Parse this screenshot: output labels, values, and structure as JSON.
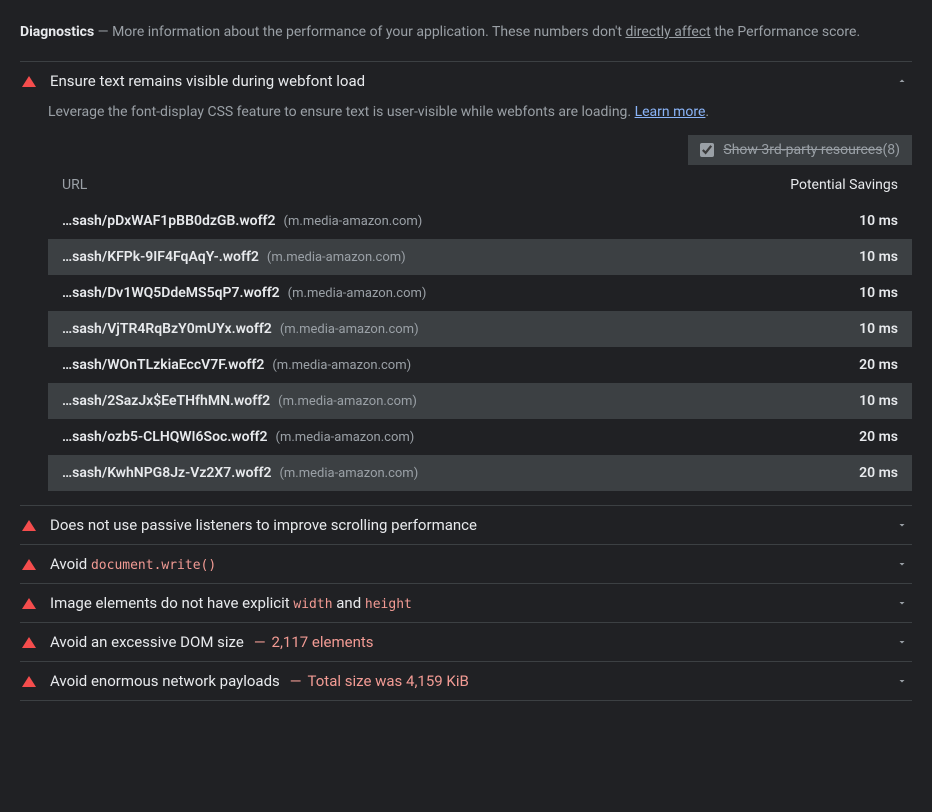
{
  "header": {
    "title": "Diagnostics",
    "dash": " — ",
    "intro1": "More information about the performance of your application. These numbers don't ",
    "link": "directly affect",
    "intro2": " the Performance score."
  },
  "audit0": {
    "title": "Ensure text remains visible during webfont load",
    "desc1": "Leverage the font-display CSS feature to ensure text is user-visible while webfonts are loading. ",
    "learn": "Learn more",
    "desc2": ".",
    "thirdPartyLabel": "Show 3rd-party resources",
    "thirdPartyCount": " (8)",
    "colUrl": "URL",
    "colSavings": "Potential Savings",
    "rows": [
      {
        "url": "…sash/pDxWAF1pBB0dzGB.woff2",
        "host": "(m.media-amazon.com)",
        "savings": "10 ms"
      },
      {
        "url": "…sash/KFPk-9IF4FqAqY-.woff2",
        "host": "(m.media-amazon.com)",
        "savings": "10 ms"
      },
      {
        "url": "…sash/Dv1WQ5DdeMS5qP7.woff2",
        "host": "(m.media-amazon.com)",
        "savings": "10 ms"
      },
      {
        "url": "…sash/VjTR4RqBzY0mUYx.woff2",
        "host": "(m.media-amazon.com)",
        "savings": "10 ms"
      },
      {
        "url": "…sash/WOnTLzkiaEccV7F.woff2",
        "host": "(m.media-amazon.com)",
        "savings": "20 ms"
      },
      {
        "url": "…sash/2SazJx$EeTHfhMN.woff2",
        "host": "(m.media-amazon.com)",
        "savings": "10 ms"
      },
      {
        "url": "…sash/ozb5-CLHQWI6Soc.woff2",
        "host": "(m.media-amazon.com)",
        "savings": "20 ms"
      },
      {
        "url": "…sash/KwhNPG8Jz-Vz2X7.woff2",
        "host": "(m.media-amazon.com)",
        "savings": "20 ms"
      }
    ]
  },
  "audits": [
    {
      "title": "Does not use passive listeners to improve scrolling performance"
    }
  ],
  "audit_avoid_docwrite": {
    "prefix": "Avoid ",
    "code": "document.write()"
  },
  "audit_img_dims": {
    "p1": "Image elements do not have explicit ",
    "c1": "width",
    "p2": " and ",
    "c2": "height"
  },
  "audit_dom": {
    "title": "Avoid an excessive DOM size",
    "dash": "—",
    "value": "2,117 elements"
  },
  "audit_payload": {
    "title": "Avoid enormous network payloads",
    "dash": "—",
    "value": "Total size was 4,159 KiB"
  }
}
